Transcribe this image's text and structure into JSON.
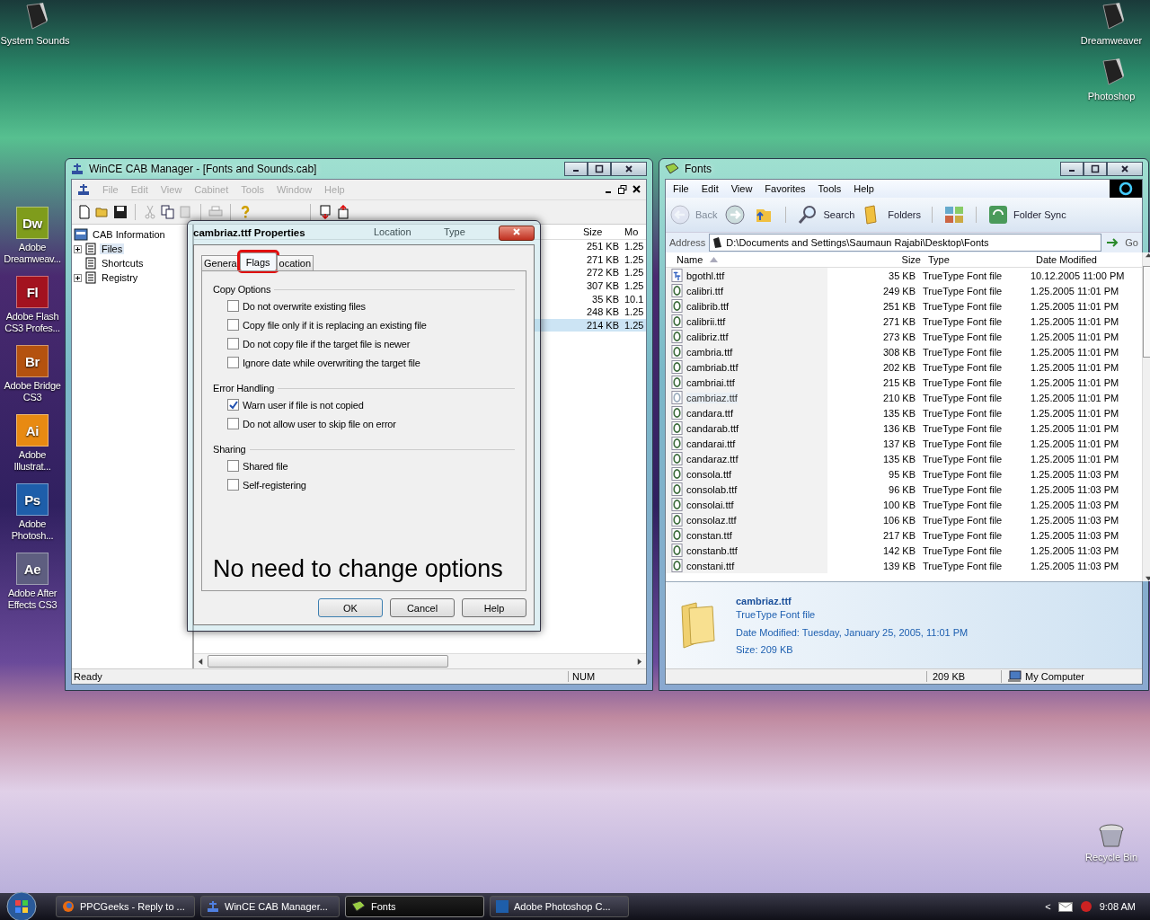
{
  "desktop": {
    "top_left": [
      {
        "label": "System Sounds",
        "kind": "device"
      }
    ],
    "top_right": [
      {
        "label": "Dreamweaver",
        "kind": "device"
      },
      {
        "label": "Photoshop",
        "kind": "device"
      }
    ],
    "left_column": [
      {
        "label": "Adobe Dreamweav...",
        "kind": "app",
        "badge": "Dw",
        "color": "#7f9c1c"
      },
      {
        "label": "Adobe Flash CS3 Profes...",
        "kind": "app",
        "badge": "Fl",
        "color": "#a3121f"
      },
      {
        "label": "Adobe Bridge CS3",
        "kind": "app",
        "badge": "Br",
        "color": "#b4520f"
      },
      {
        "label": "Adobe Illustrat...",
        "kind": "app",
        "badge": "Ai",
        "color": "#e88a12"
      },
      {
        "label": "Adobe Photosh...",
        "kind": "app",
        "badge": "Ps",
        "color": "#1e5eaa"
      },
      {
        "label": "Adobe After Effects CS3",
        "kind": "app",
        "badge": "Ae",
        "color": "#5e5e80"
      }
    ],
    "bottom_right": [
      {
        "label": "Recycle Bin",
        "kind": "bin"
      }
    ]
  },
  "cab_window": {
    "title": "WinCE CAB Manager - [Fonts and Sounds.cab]",
    "menu": [
      {
        "label": "File",
        "disabled": true
      },
      {
        "label": "Edit",
        "disabled": true
      },
      {
        "label": "View",
        "disabled": true
      },
      {
        "label": "Cabinet",
        "disabled": true
      },
      {
        "label": "Tools",
        "disabled": true
      },
      {
        "label": "Window",
        "disabled": true
      },
      {
        "label": "Help",
        "disabled": true
      }
    ],
    "tree": [
      {
        "label": "CAB Information",
        "selected": false,
        "children": [
          {
            "label": "Files",
            "selected": true,
            "expanded": false
          },
          {
            "label": "Shortcuts",
            "selected": false
          },
          {
            "label": "Registry",
            "selected": false,
            "expanded": false
          }
        ]
      }
    ],
    "columns": [
      "Location",
      "Type",
      "Size",
      "Mo"
    ],
    "rows": [
      {
        "size": "251 KB",
        "column_4": "1.25",
        "selected": false
      },
      {
        "size": "271 KB",
        "column_4": "1.25",
        "selected": false
      },
      {
        "size": "272 KB",
        "column_4": "1.25",
        "selected": false
      },
      {
        "size": "307 KB",
        "column_4": "1.25",
        "selected": false
      },
      {
        "size": "35 KB",
        "column_4": "10.1",
        "selected": false
      },
      {
        "size": "248 KB",
        "column_4": "1.25",
        "selected": false
      },
      {
        "size": "214 KB",
        "column_4": "1.25",
        "selected": true
      }
    ],
    "status_bar": [
      "Ready",
      "NUM"
    ]
  },
  "properties_dialog": {
    "title": "cambriaz.ttf Properties",
    "tabs": [
      {
        "label": "Genera",
        "selected": false,
        "highlighted": false
      },
      {
        "label": "Flags",
        "selected": true,
        "highlighted": true
      },
      {
        "label": "ocation",
        "selected": false,
        "highlighted": false
      }
    ],
    "groups": [
      {
        "title": "Copy Options",
        "options": [
          {
            "label": "Do not overwrite existing files",
            "checked": false
          },
          {
            "label": "Copy file only if it is replacing an existing file",
            "checked": false
          },
          {
            "label": "Do not copy file if the target file is newer",
            "checked": false
          },
          {
            "label": "Ignore date while overwriting the target file",
            "checked": false
          }
        ]
      },
      {
        "title": "Error Handling",
        "options": [
          {
            "label": "Warn user if file is not copied",
            "checked": true
          },
          {
            "label": "Do not allow user to skip file on error",
            "checked": false
          }
        ]
      },
      {
        "title": "Sharing",
        "options": [
          {
            "label": "Shared file",
            "checked": false
          },
          {
            "label": "Self-registering",
            "checked": false
          }
        ]
      }
    ],
    "note": "No need to change options",
    "buttons": [
      "OK",
      "Cancel",
      "Help"
    ]
  },
  "fonts_window": {
    "title": "Fonts",
    "menu": [
      "File",
      "Edit",
      "View",
      "Favorites",
      "Tools",
      "Help"
    ],
    "toolbar": [
      {
        "kind": "back",
        "label": "Back",
        "disabled": true
      },
      {
        "kind": "forward",
        "disabled": false
      },
      {
        "kind": "up",
        "disabled": false
      },
      {
        "kind": "search",
        "label": "Search",
        "disabled": false
      },
      {
        "kind": "folders",
        "label": "Folders",
        "disabled": false
      },
      {
        "kind": "views",
        "disabled": false
      },
      {
        "kind": "sync",
        "label": "Folder Sync",
        "disabled": false
      }
    ],
    "address_label": "Address",
    "address": "D:\\Documents and Settings\\Saumaun Rajabi\\Desktop\\Fonts",
    "go": "Go",
    "columns": [
      {
        "label": "Name",
        "sorted": true
      },
      {
        "label": "Size",
        "sorted": false
      },
      {
        "label": "Type",
        "sorted": false
      },
      {
        "label": "Date Modified",
        "sorted": false
      }
    ],
    "rows": [
      {
        "name": "bgothl.ttf",
        "size": "35 KB",
        "type": "TrueType Font file",
        "date": "10.12.2005 11:00 PM",
        "kind": "truetype",
        "selected": false
      },
      {
        "name": "calibri.ttf",
        "size": "249 KB",
        "type": "TrueType Font file",
        "date": "1.25.2005 11:01 PM",
        "kind": "opentype",
        "selected": false
      },
      {
        "name": "calibrib.ttf",
        "size": "251 KB",
        "type": "TrueType Font file",
        "date": "1.25.2005 11:01 PM",
        "kind": "opentype",
        "selected": false
      },
      {
        "name": "calibrii.ttf",
        "size": "271 KB",
        "type": "TrueType Font file",
        "date": "1.25.2005 11:01 PM",
        "kind": "opentype",
        "selected": false
      },
      {
        "name": "calibriz.ttf",
        "size": "273 KB",
        "type": "TrueType Font file",
        "date": "1.25.2005 11:01 PM",
        "kind": "opentype",
        "selected": false
      },
      {
        "name": "cambria.ttf",
        "size": "308 KB",
        "type": "TrueType Font file",
        "date": "1.25.2005 11:01 PM",
        "kind": "opentype",
        "selected": false
      },
      {
        "name": "cambriab.ttf",
        "size": "202 KB",
        "type": "TrueType Font file",
        "date": "1.25.2005 11:01 PM",
        "kind": "opentype",
        "selected": false
      },
      {
        "name": "cambriai.ttf",
        "size": "215 KB",
        "type": "TrueType Font file",
        "date": "1.25.2005 11:01 PM",
        "kind": "opentype",
        "selected": false
      },
      {
        "name": "cambriaz.ttf",
        "size": "210 KB",
        "type": "TrueType Font file",
        "date": "1.25.2005 11:01 PM",
        "kind": "opentype",
        "selected": true
      },
      {
        "name": "candara.ttf",
        "size": "135 KB",
        "type": "TrueType Font file",
        "date": "1.25.2005 11:01 PM",
        "kind": "opentype",
        "selected": false
      },
      {
        "name": "candarab.ttf",
        "size": "136 KB",
        "type": "TrueType Font file",
        "date": "1.25.2005 11:01 PM",
        "kind": "opentype",
        "selected": false
      },
      {
        "name": "candarai.ttf",
        "size": "137 KB",
        "type": "TrueType Font file",
        "date": "1.25.2005 11:01 PM",
        "kind": "opentype",
        "selected": false
      },
      {
        "name": "candaraz.ttf",
        "size": "135 KB",
        "type": "TrueType Font file",
        "date": "1.25.2005 11:01 PM",
        "kind": "opentype",
        "selected": false
      },
      {
        "name": "consola.ttf",
        "size": "95 KB",
        "type": "TrueType Font file",
        "date": "1.25.2005 11:03 PM",
        "kind": "opentype",
        "selected": false
      },
      {
        "name": "consolab.ttf",
        "size": "96 KB",
        "type": "TrueType Font file",
        "date": "1.25.2005 11:03 PM",
        "kind": "opentype",
        "selected": false
      },
      {
        "name": "consolai.ttf",
        "size": "100 KB",
        "type": "TrueType Font file",
        "date": "1.25.2005 11:03 PM",
        "kind": "opentype",
        "selected": false
      },
      {
        "name": "consolaz.ttf",
        "size": "106 KB",
        "type": "TrueType Font file",
        "date": "1.25.2005 11:03 PM",
        "kind": "opentype",
        "selected": false
      },
      {
        "name": "constan.ttf",
        "size": "217 KB",
        "type": "TrueType Font file",
        "date": "1.25.2005 11:03 PM",
        "kind": "opentype",
        "selected": false
      },
      {
        "name": "constanb.ttf",
        "size": "142 KB",
        "type": "TrueType Font file",
        "date": "1.25.2005 11:03 PM",
        "kind": "opentype",
        "selected": false
      },
      {
        "name": "constani.ttf",
        "size": "139 KB",
        "type": "TrueType Font file",
        "date": "1.25.2005 11:03 PM",
        "kind": "opentype",
        "selected": false
      }
    ],
    "details": {
      "name": "cambriaz.ttf",
      "type": "TrueType Font file",
      "date_modified": "Date Modified: Tuesday, January 25, 2005, 11:01 PM",
      "size": "Size: 209 KB"
    },
    "status_bar": {
      "size": "209 KB",
      "zone": "My Computer"
    }
  },
  "taskbar": {
    "buttons": [
      {
        "label": "PPCGeeks - Reply to ...",
        "kind": "browser",
        "selected": false
      },
      {
        "label": "WinCE CAB Manager...",
        "kind": "cab",
        "selected": false
      },
      {
        "label": "Fonts",
        "kind": "folder",
        "selected": true
      },
      {
        "label": "Adobe Photoshop C...",
        "kind": "photoshop",
        "selected": false
      }
    ],
    "tray_arrow": "<",
    "clock": "9:08 AM"
  }
}
